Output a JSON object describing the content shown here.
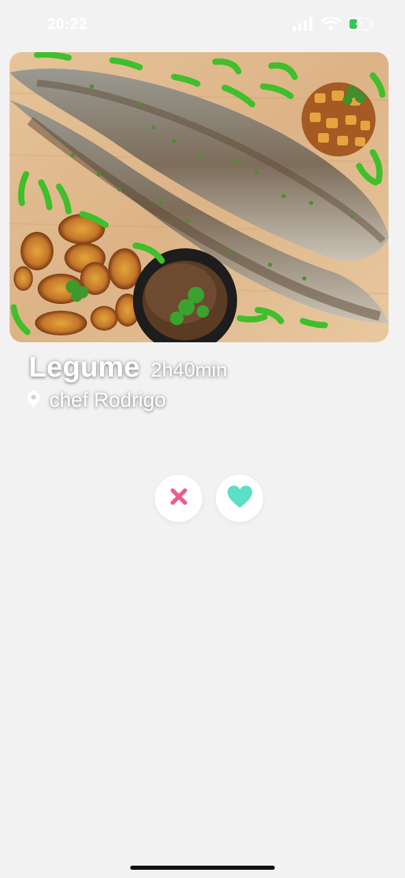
{
  "status_bar": {
    "time": "20:22",
    "icons": [
      "cellular-signal-icon",
      "wifi-icon",
      "battery-charging-icon"
    ]
  },
  "card": {
    "image": "grilled-fish-plantains-platter-image",
    "dish_name": "Legume",
    "duration": "2h40min",
    "chef": "chef Rodrigo",
    "location_icon": "location-pin-icon"
  },
  "actions": {
    "dislike_icon": "close-x-icon",
    "like_icon": "heart-icon"
  },
  "colors": {
    "background": "#f2f2f2",
    "dislike": "#ec5d8a",
    "like": "#59e0c5",
    "text_overlay": "#ffffff"
  }
}
